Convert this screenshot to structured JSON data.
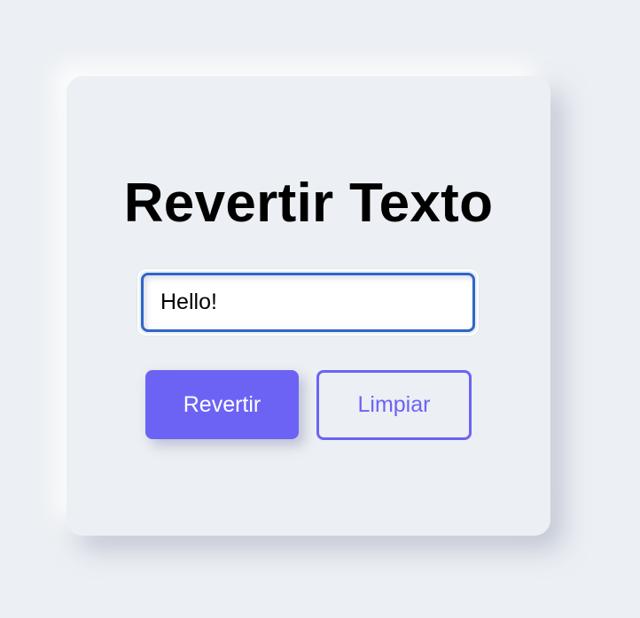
{
  "app": {
    "title": "Revertir Texto"
  },
  "form": {
    "input_value": "Hello!",
    "input_placeholder": ""
  },
  "buttons": {
    "reverse_label": "Revertir",
    "clear_label": "Limpiar"
  },
  "colors": {
    "background": "#eceff3",
    "accent": "#6c63f5",
    "input_border": "#2f66c9",
    "title_text": "#000000"
  }
}
